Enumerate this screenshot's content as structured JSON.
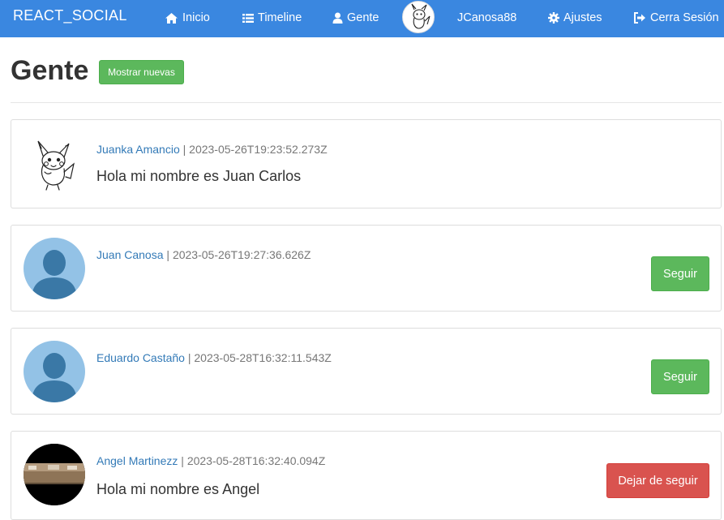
{
  "navbar": {
    "brand": "REACT_SOCIAL",
    "inicio": "Inicio",
    "timeline": "Timeline",
    "gente": "Gente",
    "username": "JCanosa88",
    "ajustes": "Ajustes",
    "logout": "Cerra Sesión",
    "icons": [
      "home-icon",
      "list-icon",
      "user-icon",
      "gear-icon",
      "sign-out-icon"
    ]
  },
  "page": {
    "title": "Gente",
    "show_new_label": "Mostrar nuevas"
  },
  "people": [
    {
      "author": "Juanka Amancio",
      "separator": "|",
      "timestamp": "2023-05-26T19:23:52.273Z",
      "text": "Hola mi nombre es Juan Carlos",
      "avatar": "pikachu-drawing"
    },
    {
      "author": "Juan Canosa",
      "separator": "|",
      "timestamp": "2023-05-26T19:27:36.626Z",
      "text": "",
      "avatar": "default-user-silhouette",
      "action": "Seguir"
    },
    {
      "author": "Eduardo Castaño",
      "separator": "|",
      "timestamp": "2023-05-28T16:32:11.543Z",
      "text": "",
      "avatar": "default-user-silhouette",
      "action": "Seguir"
    },
    {
      "author": "Angel Martinezz",
      "separator": "|",
      "timestamp": "2023-05-28T16:32:40.094Z",
      "text": "Hola mi nombre es Angel",
      "avatar": "photo",
      "action": "Dejar de seguir"
    }
  ],
  "colors": {
    "navbar": "#3a87e0",
    "success": "#5cb85c",
    "danger": "#d9534f",
    "link": "#337ab7"
  }
}
